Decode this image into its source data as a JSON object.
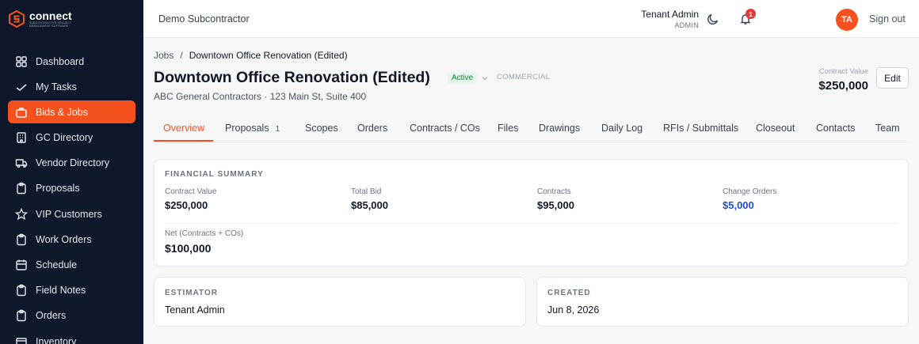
{
  "brand": {
    "name": "connect",
    "tagline": "SUBCONTRACTOR PROJECT MANAGEMENT SOFTWARE"
  },
  "sidebar": {
    "items": [
      {
        "label": "Dashboard",
        "icon": "grid-icon",
        "active": false
      },
      {
        "label": "My Tasks",
        "icon": "check-icon",
        "active": false
      },
      {
        "label": "Bids & Jobs",
        "icon": "briefcase-icon",
        "active": true
      },
      {
        "label": "GC Directory",
        "icon": "building-icon",
        "active": false
      },
      {
        "label": "Vendor Directory",
        "icon": "truck-icon",
        "active": false
      },
      {
        "label": "Proposals",
        "icon": "clipboard-icon",
        "active": false
      },
      {
        "label": "VIP Customers",
        "icon": "star-icon",
        "active": false
      },
      {
        "label": "Work Orders",
        "icon": "clipboard-icon",
        "active": false
      },
      {
        "label": "Schedule",
        "icon": "calendar-icon",
        "active": false
      },
      {
        "label": "Field Notes",
        "icon": "clipboard-icon",
        "active": false
      },
      {
        "label": "Orders",
        "icon": "clipboard-icon",
        "active": false
      },
      {
        "label": "Inventory",
        "icon": "box-icon",
        "active": false
      }
    ]
  },
  "topbar": {
    "tenant": "Demo Subcontractor",
    "notification_count": "1",
    "user_name": "Tenant Admin",
    "user_role": "ADMIN",
    "avatar_initials": "TA",
    "signout_label": "Sign out"
  },
  "job": {
    "breadcrumb_parent": "Jobs",
    "breadcrumb_separator": "/",
    "breadcrumb_current": "Downtown Office Renovation (Edited)",
    "title": "Downtown Office Renovation (Edited)",
    "status": "Active",
    "type": "COMMERCIAL",
    "subtitle": "ABC General Contractors · 123 Main St, Suite 400",
    "contract_value_label": "Contract Value",
    "contract_value": "$250,000",
    "edit_label": "Edit"
  },
  "tabs": [
    {
      "label": "Overview",
      "count": "",
      "active": true
    },
    {
      "label": "Proposals",
      "count": "1",
      "active": false
    },
    {
      "label": "Scopes",
      "count": "",
      "active": false
    },
    {
      "label": "Orders",
      "count": "",
      "active": false
    },
    {
      "label": "Contracts / COs",
      "count": "",
      "active": false
    },
    {
      "label": "Files",
      "count": "",
      "active": false
    },
    {
      "label": "Drawings",
      "count": "",
      "active": false
    },
    {
      "label": "Daily Log",
      "count": "",
      "active": false
    },
    {
      "label": "RFIs / Submittals",
      "count": "",
      "active": false
    },
    {
      "label": "Closeout",
      "count": "",
      "active": false
    },
    {
      "label": "Contacts",
      "count": "",
      "active": false
    },
    {
      "label": "Team",
      "count": "",
      "active": false
    }
  ],
  "financial": {
    "title": "FINANCIAL SUMMARY",
    "items": [
      {
        "label": "Contract Value",
        "value": "$250,000"
      },
      {
        "label": "Total Bid",
        "value": "$85,000"
      },
      {
        "label": "Contracts",
        "value": "$95,000"
      },
      {
        "label": "Change Orders",
        "value": "$5,000"
      }
    ],
    "net_label": "Net (Contracts + COs)",
    "net_value": "$100,000"
  },
  "estimator": {
    "title": "ESTIMATOR",
    "value": "Tenant Admin"
  },
  "created": {
    "title": "CREATED",
    "value": "Jun 8, 2026"
  },
  "colors": {
    "accent": "#f4511e",
    "sidebar_bg": "#0f172a",
    "link_blue": "#1d4ed8",
    "status_green": "#15803d"
  }
}
